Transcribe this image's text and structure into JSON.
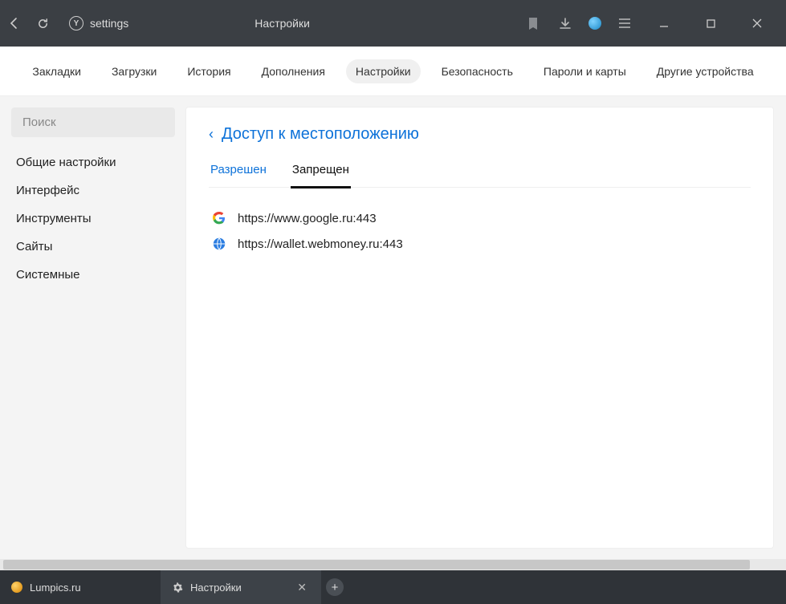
{
  "titlebar": {
    "address": "settings",
    "page_title": "Настройки"
  },
  "topnav": {
    "items": [
      {
        "label": "Закладки"
      },
      {
        "label": "Загрузки"
      },
      {
        "label": "История"
      },
      {
        "label": "Дополнения"
      },
      {
        "label": "Настройки"
      },
      {
        "label": "Безопасность"
      },
      {
        "label": "Пароли и карты"
      },
      {
        "label": "Другие устройства"
      }
    ],
    "active_index": 4
  },
  "sidebar": {
    "search_placeholder": "Поиск",
    "items": [
      {
        "label": "Общие настройки"
      },
      {
        "label": "Интерфейс"
      },
      {
        "label": "Инструменты"
      },
      {
        "label": "Сайты"
      },
      {
        "label": "Системные"
      }
    ]
  },
  "content": {
    "header": "Доступ к местоположению",
    "tabs": [
      {
        "label": "Разрешен"
      },
      {
        "label": "Запрещен"
      }
    ],
    "active_tab": 1,
    "sites": [
      {
        "icon": "google",
        "url": "https://www.google.ru:443"
      },
      {
        "icon": "globe",
        "url": "https://wallet.webmoney.ru:443"
      }
    ]
  },
  "tabbar": {
    "tabs": [
      {
        "icon": "orange",
        "label": "Lumpics.ru"
      },
      {
        "icon": "gear",
        "label": "Настройки"
      }
    ],
    "active_index": 1
  }
}
